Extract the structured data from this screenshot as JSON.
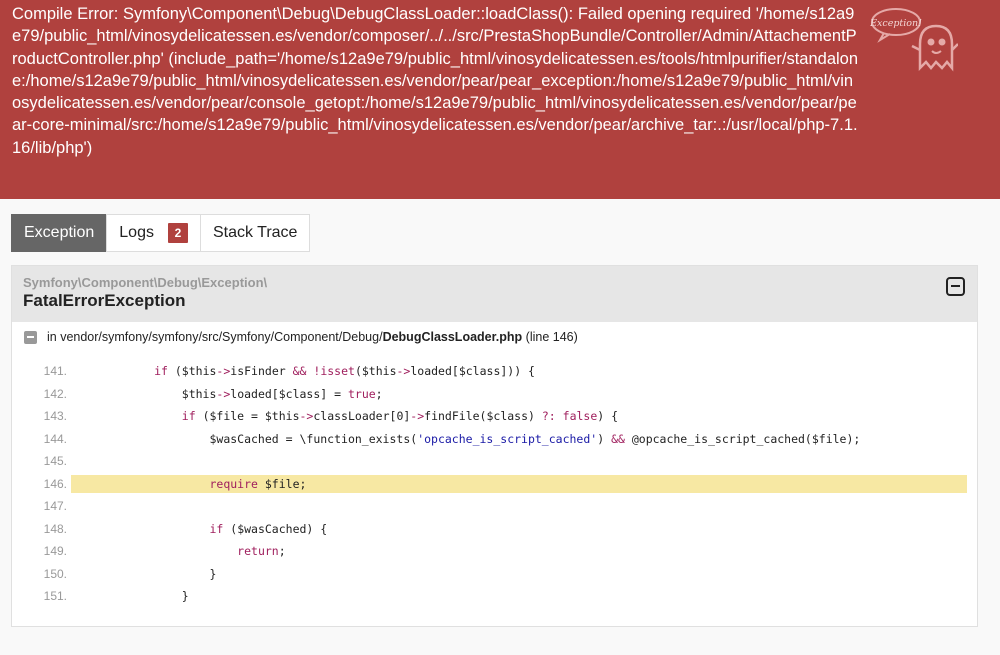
{
  "error": {
    "message": "Compile Error: Symfony\\Component\\Debug\\DebugClassLoader::loadClass(): Failed opening required '/home/s12a9e79/public_html/vinosydelicatessen.es/vendor/composer/../../src/PrestaShopBundle/Controller/Admin/AttachementProductController.php' (include_path='/home/s12a9e79/public_html/vinosydelicatessen.es/tools/htmlpurifier/standalone:/home/s12a9e79/public_html/vinosydelicatessen.es/vendor/pear/pear_exception:/home/s12a9e79/public_html/vinosydelicatessen.es/vendor/pear/console_getopt:/home/s12a9e79/public_html/vinosydelicatessen.es/vendor/pear/pear-core-minimal/src:/home/s12a9e79/public_html/vinosydelicatessen.es/vendor/pear/archive_tar:.:/usr/local/php-7.1.16/lib/php')",
    "logo_text": "Exception!",
    "logo_icon": "ghost-icon"
  },
  "tabs": [
    {
      "label": "Exception",
      "active": true
    },
    {
      "label": "Logs",
      "badge": "2"
    },
    {
      "label": "Stack Trace"
    }
  ],
  "exception": {
    "namespace": "Symfony\\Component\\Debug\\Exception\\",
    "class": "FatalErrorException",
    "location_prefix": "in vendor/symfony/symfony/src/Symfony/Component/Debug/",
    "location_file": "DebugClassLoader.php",
    "location_suffix": "(line 146)"
  },
  "code": [
    {
      "line": "141.",
      "text": "            if ($this->isFinder && !isset($this->loaded[$class])) {"
    },
    {
      "line": "142.",
      "text": "                $this->loaded[$class] = true;"
    },
    {
      "line": "143.",
      "text": "                if ($file = $this->classLoader[0]->findFile($class) ?: false) {"
    },
    {
      "line": "144.",
      "text": "                    $wasCached = \\function_exists('opcache_is_script_cached') && @opcache_is_script_cached($file);"
    },
    {
      "line": "145.",
      "text": ""
    },
    {
      "line": "146.",
      "text": "                    require $file;",
      "highlight": true
    },
    {
      "line": "147.",
      "text": ""
    },
    {
      "line": "148.",
      "text": "                    if ($wasCached) {"
    },
    {
      "line": "149.",
      "text": "                        return;"
    },
    {
      "line": "150.",
      "text": "                    }"
    },
    {
      "line": "151.",
      "text": "                }"
    }
  ],
  "colors": {
    "header_bg": "#b0413e",
    "highlight": "#f7e8a3",
    "active_tab": "#666666"
  }
}
